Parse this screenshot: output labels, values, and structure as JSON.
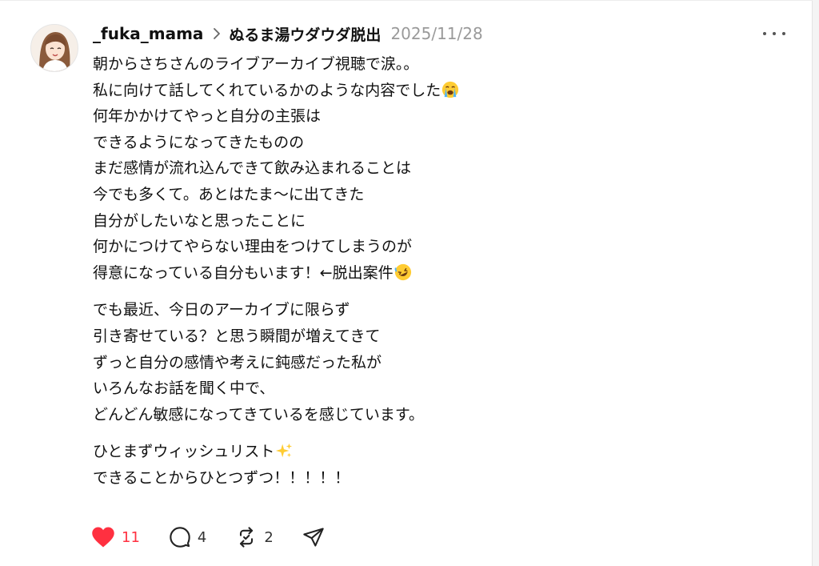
{
  "post": {
    "username": "_fuka_mama",
    "community": "ぬるま湯ウダウダ脱出",
    "date": "2025/11/28",
    "paragraphs": [
      [
        "朝からさちさんのライブアーカイブ視聴で涙。。",
        "私に向けて話してくれているかのような内容でした",
        "何年かかけてやっと自分の主張は",
        "できるようになってきたものの",
        "まだ感情が流れ込んできて飲み込まれることは",
        "今でも多くて。あとはたま〜に出てきた",
        "自分がしたいなと思ったことに",
        "何かにつけてやらない理由をつけてしまうのが",
        "得意になっている自分もいます！←脱出案件"
      ],
      [
        "でも最近、今日のアーカイブに限らず",
        "引き寄せている？と思う瞬間が増えてきて",
        "ずっと自分の感情や考えに鈍感だった私が",
        "いろんなお話を聞く中で、",
        "どんどん敏感になってきているを感じています。"
      ],
      [
        "ひとまずウィッシュリスト",
        "できることからひとつずつ！！！！！"
      ]
    ],
    "emojis": {
      "crying": "loudly-crying-face-icon",
      "rofl": "rolling-on-floor-laughing-icon",
      "sparkles": "sparkles-icon"
    }
  },
  "actions": {
    "like_count": "11",
    "reply_count": "4",
    "repost_count": "2",
    "like_color": "#ff3040"
  }
}
